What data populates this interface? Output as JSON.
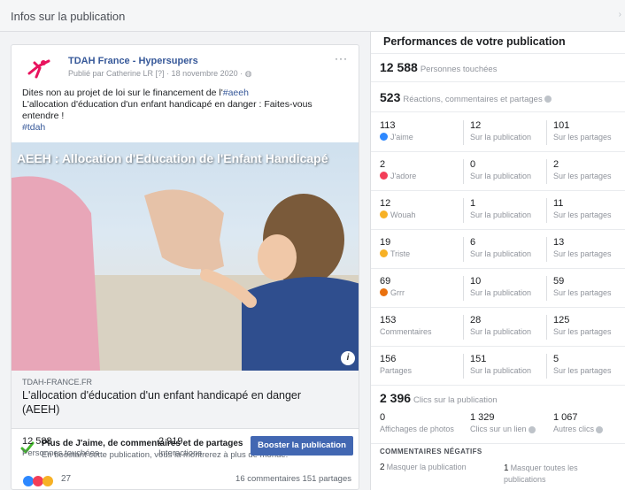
{
  "header": {
    "title": "Infos sur la publication",
    "close": "›"
  },
  "post": {
    "page_name": "TDAH France - Hypersupers",
    "meta": "Publié par Catherine LR [?] · 18 novembre 2020 · ",
    "more": "···",
    "text_line1_pre": "Dites non au projet de loi sur le financement de l'",
    "text_line1_link": "#aeeh",
    "text_line2": "L'allocation d'éducation d'un enfant handicapé en danger : Faites-vous entendre !",
    "text_hashtag": "#tdah",
    "image_overlay": "AEEH : Allocation d'Education de l'Enfant Handicapé",
    "info_glyph": "i",
    "link_domain": "TDAH-FRANCE.FR",
    "link_title": "L'allocation d'éducation d'un enfant handicapé en danger (AEEH)",
    "boost_title": "Plus de J'aime, de commentaires et de partages",
    "boost_sub": "En boostant cette publication, vous la montrerez à plus de monde.",
    "reach_value": "12 588",
    "reach_label": "Personnes touchées",
    "interactions_value": "2 919",
    "interactions_label": "Interactions",
    "boost_button": "Booster la publication",
    "reactions_count": "27",
    "comments_shares": "16 commentaires  151 partages"
  },
  "panel": {
    "title": "Performances de votre publication",
    "reach_num": "12 588",
    "reach_lbl": "Personnes touchées",
    "engage_num": "523",
    "engage_lbl": "Réactions, commentaires et partages",
    "rows": [
      {
        "v1": "113",
        "l1": "J'aime",
        "v2": "12",
        "l2": "Sur la publication",
        "v3": "101",
        "l3": "Sur les partages",
        "icon_color": "#2d88ff"
      },
      {
        "v1": "2",
        "l1": "J'adore",
        "v2": "0",
        "l2": "Sur la publication",
        "v3": "2",
        "l3": "Sur les partages",
        "icon_color": "#f33e58"
      },
      {
        "v1": "12",
        "l1": "Wouah",
        "v2": "1",
        "l2": "Sur la publication",
        "v3": "11",
        "l3": "Sur les partages",
        "icon_color": "#f7b125"
      },
      {
        "v1": "19",
        "l1": "Triste",
        "v2": "6",
        "l2": "Sur la publication",
        "v3": "13",
        "l3": "Sur les partages",
        "icon_color": "#f7b125"
      },
      {
        "v1": "69",
        "l1": "Grrr",
        "v2": "10",
        "l2": "Sur la publication",
        "v3": "59",
        "l3": "Sur les partages",
        "icon_color": "#e9710f"
      },
      {
        "v1": "153",
        "l1": "Commentaires",
        "v2": "28",
        "l2": "Sur la publication",
        "v3": "125",
        "l3": "Sur les partages",
        "icon_color": ""
      },
      {
        "v1": "156",
        "l1": "Partages",
        "v2": "151",
        "l2": "Sur la publication",
        "v3": "5",
        "l3": "Sur les partages",
        "icon_color": ""
      }
    ],
    "clicks_num": "2 396",
    "clicks_lbl": "Clics sur la publication",
    "click_cells": [
      {
        "v": "0",
        "l": "Affichages de photos"
      },
      {
        "v": "1 329",
        "l": "Clics sur un lien"
      },
      {
        "v": "1 067",
        "l": "Autres clics"
      }
    ],
    "negative_title": "COMMENTAIRES NÉGATIFS",
    "neg1_num": "2",
    "neg1_lbl": "Masquer la publication",
    "neg2_num": "1",
    "neg2_lbl": "Masquer toutes les publications"
  },
  "colors": {
    "brand": "#4267b2",
    "link": "#365899",
    "logo": "#e8135e",
    "check": "#42b72a"
  }
}
